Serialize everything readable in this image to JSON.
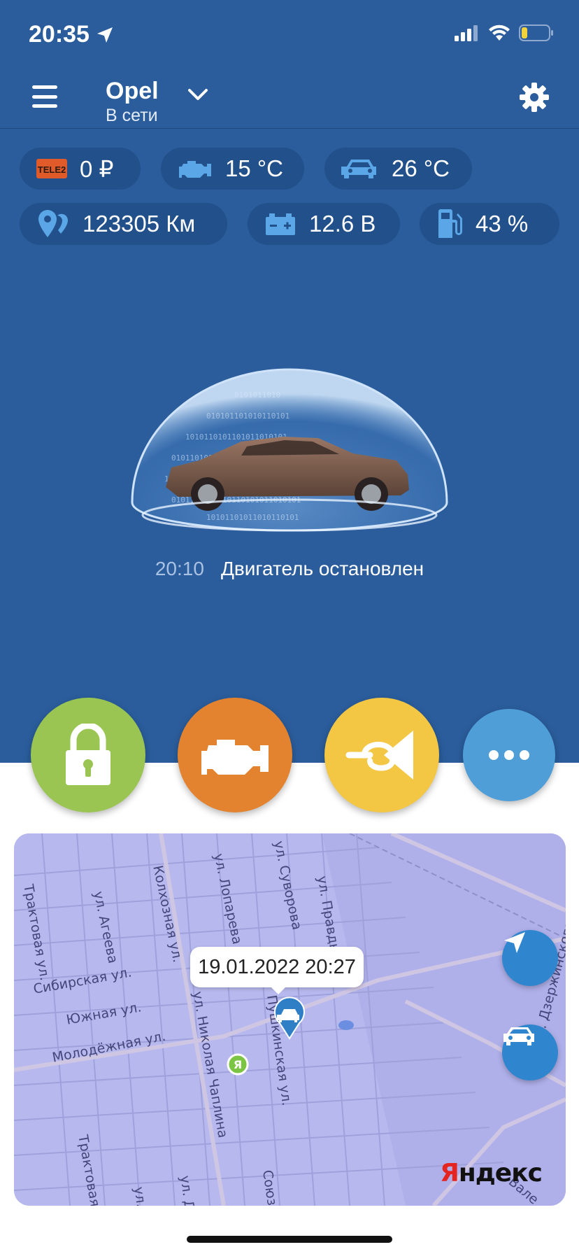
{
  "status_bar": {
    "time": "20:35"
  },
  "header": {
    "car_name": "Opel",
    "connection_status": "В сети"
  },
  "chips": {
    "balance": "0 ₽",
    "engine_temp": "15 °C",
    "cabin_temp": "26 °C",
    "mileage": "123305 Км",
    "battery": "12.6 В",
    "fuel": "43 %"
  },
  "operator_logo_text": "TELE2",
  "event": {
    "time": "20:10",
    "message": "Двигатель остановлен"
  },
  "actions": [
    "lock",
    "engine",
    "horn",
    "more"
  ],
  "colors": {
    "lock": "#9bc553",
    "engine": "#e4832f",
    "horn": "#f3c644",
    "more": "#4f9ed8",
    "background": "#2b5d9c"
  },
  "map": {
    "timestamp": "19.01.2022 20:27",
    "brand_letter": "Я",
    "brand_rest": "ндекс",
    "streets": {
      "traktovaya_1": "Трактовая ул.",
      "ageeva": "ул. Агеева",
      "kolkhoznaya": "Колхозная ул.",
      "lopareva": "ул. Лопарева",
      "suvorova": "ул. Суворова",
      "pravdy": "ул. Правды",
      "sibirskaya": "Сибирская ул.",
      "yuzhnaya": "Южная ул.",
      "molodezhnaya": "Молодёжная ул.",
      "nikolaya_chaplina": "ул. Николая Чаплина",
      "pushkinskaya": "Пушкинская ул.",
      "traktovaya_2": "Трактовая ул.",
      "soyuz": "Союз",
      "ul_1": "ул.",
      "ul_2": "ул. Д",
      "vale": "Вале",
      "right_edge": "ул. Дзержинского"
    }
  }
}
